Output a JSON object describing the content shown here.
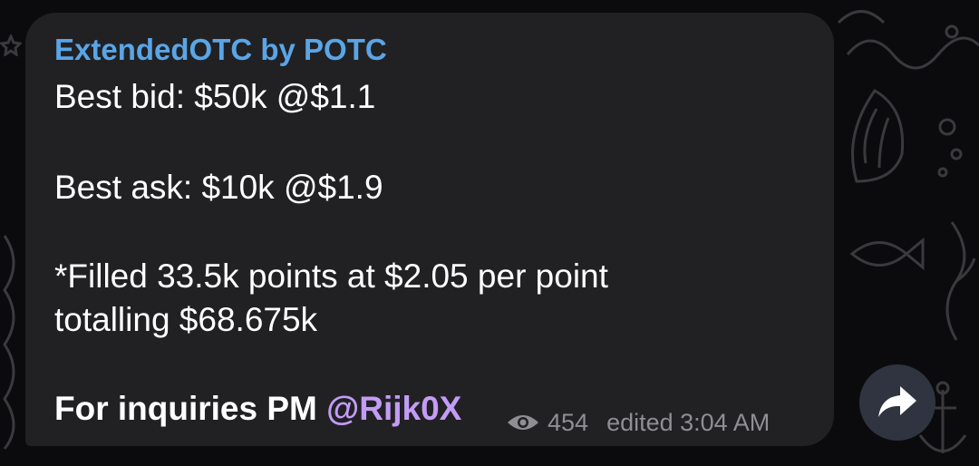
{
  "message": {
    "sender": "ExtendedOTC by POTC",
    "lines": {
      "bid": "Best bid: $50k @$1.1",
      "ask": "Best ask: $10k @$1.9",
      "filled_1": "*Filled 33.5k points at $2.05 per point",
      "filled_2": "totalling $68.675k",
      "inquiry_prefix": "For inquiries PM ",
      "mention": "@Rijk0X"
    },
    "meta": {
      "views": "454",
      "edited": "edited 3:04 AM"
    }
  },
  "icons": {
    "views": "eye-icon",
    "forward": "share-forward-icon"
  },
  "colors": {
    "sender": "#5aa5e6",
    "mention": "#c39cf5",
    "bubble": "#212124",
    "background": "#0b0b0d"
  }
}
